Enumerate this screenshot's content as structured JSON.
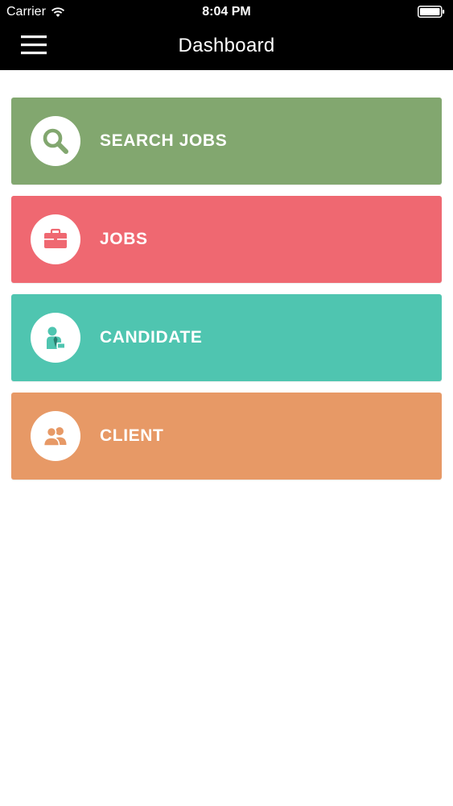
{
  "status_bar": {
    "carrier": "Carrier",
    "time": "8:04 PM"
  },
  "nav": {
    "title": "Dashboard",
    "menu_icon": "hamburger-menu-icon"
  },
  "tiles": [
    {
      "label": "SEARCH JOBS",
      "icon": "search-icon",
      "color": "#82a76f"
    },
    {
      "label": "JOBS",
      "icon": "briefcase-icon",
      "color": "#ef6871"
    },
    {
      "label": "CANDIDATE",
      "icon": "candidate-icon",
      "color": "#4fc5b0"
    },
    {
      "label": "CLIENT",
      "icon": "client-group-icon",
      "color": "#e79966"
    }
  ]
}
